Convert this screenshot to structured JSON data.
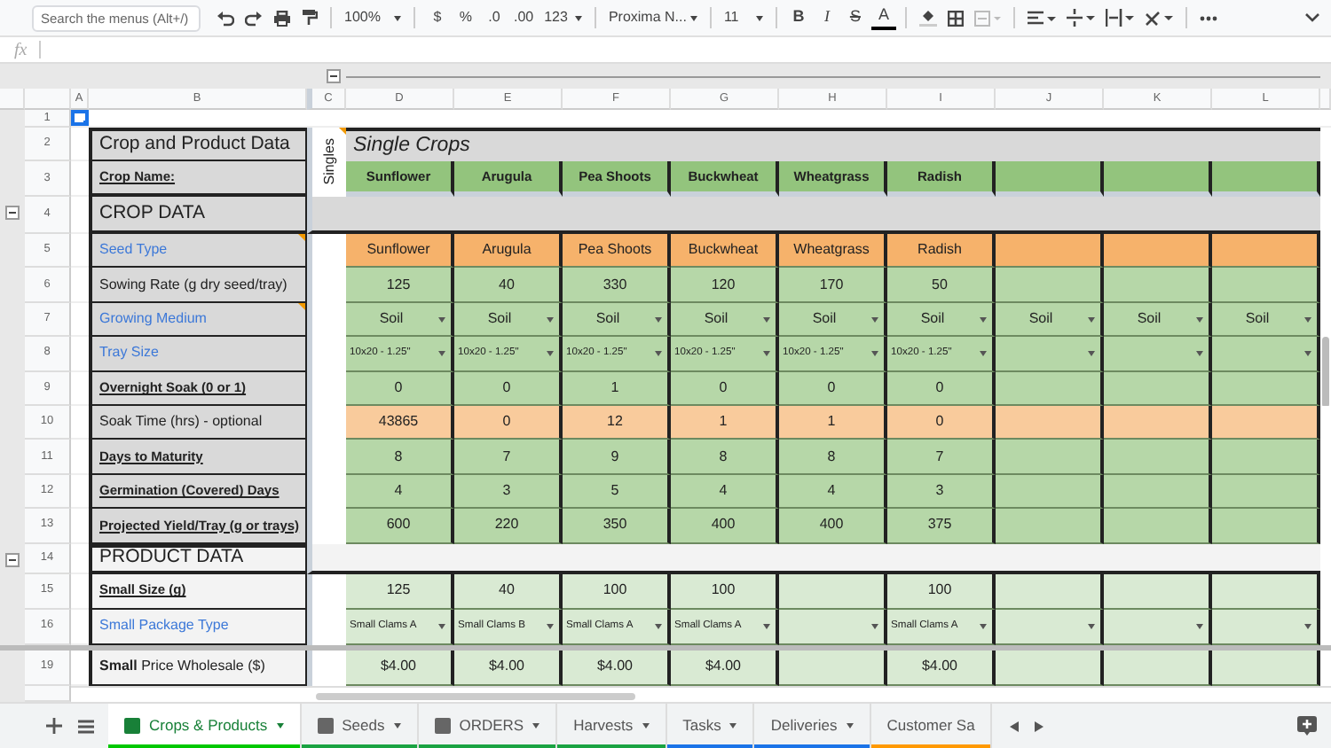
{
  "toolbar": {
    "search": {
      "placeholder": "Search the menus (Alt+/)"
    },
    "zoom": "100%",
    "currency": "$",
    "percent": "%",
    "decrease_decimals": ".0",
    "increase_decimals": ".00",
    "number_format": "123",
    "font": "Proxima N...",
    "font_size": "11",
    "format_buttons": [
      {
        "label": "B",
        "kind": "bold"
      },
      {
        "label": "I",
        "kind": "italic"
      },
      {
        "label": "S",
        "kind": "strike"
      },
      {
        "label": "A",
        "kind": "color"
      }
    ]
  },
  "formula_bar": {
    "label": "fx"
  },
  "columns": [
    "A",
    "B",
    "C",
    "D",
    "E",
    "F",
    "G",
    "H",
    "I",
    "J",
    "K",
    "L"
  ],
  "rows": [
    {
      "number": "1",
      "kind": "blank",
      "cursor": true
    },
    {
      "number": "2",
      "kind": "title",
      "label": "Crop and Product Data",
      "group_label": "Singles",
      "note": true,
      "banner": "Single Crops"
    },
    {
      "number": "3",
      "kind": "header",
      "label": "Crop Name:",
      "values": [
        "Sunflower",
        "Arugula",
        "Pea Shoots",
        "Buckwheat",
        "Wheatgrass",
        "Radish"
      ]
    },
    {
      "number": "4",
      "kind": "section",
      "label": "CROP DATA",
      "expanded": true
    },
    {
      "number": "5",
      "kind": "data",
      "label": "Seed Type",
      "link": true,
      "bold": false,
      "note": true,
      "color": "#f6b26b",
      "dropdown": false,
      "values": [
        "Sunflower",
        "Arugula",
        "Pea Shoots",
        "Buckwheat",
        "Wheatgrass",
        "Radish"
      ]
    },
    {
      "number": "6",
      "kind": "data",
      "label": "Sowing Rate (g dry seed/tray)",
      "link": false,
      "bold": false,
      "note": false,
      "color": "#b6d7a8",
      "dropdown": false,
      "values": [
        "125",
        "40",
        "330",
        "120",
        "170",
        "50"
      ]
    },
    {
      "number": "7",
      "kind": "data",
      "label": "Growing Medium",
      "link": true,
      "bold": false,
      "note": true,
      "color": "#b6d7a8",
      "dropdown": true,
      "values": [
        "Soil",
        "Soil",
        "Soil",
        "Soil",
        "Soil",
        "Soil",
        "Soil",
        "Soil",
        "Soil"
      ]
    },
    {
      "number": "8",
      "kind": "data",
      "label": "Tray Size",
      "link": true,
      "bold": false,
      "note": false,
      "color": "#b6d7a8",
      "dropdown": true,
      "values": [
        "10x20 - 1.25\"",
        "10x20 - 1.25\"",
        "10x20 - 1.25\"",
        "10x20 - 1.25\"",
        "10x20 - 1.25\"",
        "10x20 - 1.25\""
      ]
    },
    {
      "number": "9",
      "kind": "data",
      "label": "Overnight Soak (0 or 1)",
      "link": false,
      "bold": true,
      "note": false,
      "color": "#b6d7a8",
      "dropdown": false,
      "values": [
        "0",
        "0",
        "1",
        "0",
        "0",
        "0"
      ]
    },
    {
      "number": "10",
      "kind": "data",
      "label": "Soak Time (hrs) - optional",
      "link": false,
      "bold": false,
      "note": false,
      "color": "#f9cb9c",
      "dropdown": false,
      "values": [
        "43865",
        "0",
        "12",
        "1",
        "1",
        "0"
      ]
    },
    {
      "number": "11",
      "kind": "data",
      "label": "Days to Maturity",
      "link": false,
      "bold": true,
      "note": false,
      "color": "#b6d7a8",
      "dropdown": false,
      "values": [
        "8",
        "7",
        "9",
        "8",
        "8",
        "7"
      ]
    },
    {
      "number": "12",
      "kind": "data",
      "label": "Germination (Covered) Days",
      "link": false,
      "bold": true,
      "note": false,
      "color": "#b6d7a8",
      "dropdown": false,
      "values": [
        "4",
        "3",
        "5",
        "4",
        "4",
        "3"
      ]
    },
    {
      "number": "13",
      "kind": "data",
      "label": "Projected Yield/Tray (g or trays)",
      "link": false,
      "bold": true,
      "note": false,
      "color": "#b6d7a8",
      "dropdown": false,
      "values": [
        "600",
        "220",
        "350",
        "400",
        "400",
        "375"
      ]
    },
    {
      "number": "14",
      "kind": "section",
      "label": "PRODUCT DATA",
      "expanded": true
    },
    {
      "number": "15",
      "kind": "data",
      "label": "Small Size (g)",
      "link": false,
      "bold": true,
      "note": false,
      "color": "#d9ead3",
      "dropdown": false,
      "values": [
        "125",
        "40",
        "100",
        "100",
        {
          "kind": "blank"
        },
        "100"
      ]
    },
    {
      "number": "16",
      "kind": "data",
      "label": "Small Package Type",
      "link": true,
      "bold": false,
      "note": false,
      "color": "#d9ead3",
      "dropdown": true,
      "values": [
        "Small Clams A",
        "Small Clams B",
        "Small Clams A",
        "Small Clams A",
        {
          "kind": "blank"
        },
        "Small Clams A"
      ]
    },
    {
      "number": "19",
      "kind": "data",
      "label": "**Small** Price Wholesale ($)",
      "link": false,
      "bold": false,
      "hidden_rows_above": true,
      "note": false,
      "color": "#d9ead3",
      "dropdown": false,
      "values": [
        "$4.00",
        "$4.00",
        "$4.00",
        "$4.00",
        {
          "kind": "blank"
        },
        "$4.00"
      ]
    }
  ],
  "sheet_tabs": [
    {
      "label": "Crops & Products",
      "selected": true,
      "linked": true,
      "color": "#00c800"
    },
    {
      "label": "Seeds",
      "selected": false,
      "linked": true,
      "color": "#1aa342"
    },
    {
      "label": "ORDERS",
      "selected": false,
      "linked": true,
      "color": "#1aa342"
    },
    {
      "label": "Harvests",
      "selected": false,
      "linked": false,
      "color": "#1aa342"
    },
    {
      "label": "Tasks",
      "selected": false,
      "linked": false,
      "color": "#1a73e8"
    },
    {
      "label": "Deliveries",
      "selected": false,
      "linked": false,
      "color": "#1a73e8"
    },
    {
      "label": "Customer Sa",
      "selected": false,
      "linked": false,
      "color": "#ff9900"
    }
  ]
}
